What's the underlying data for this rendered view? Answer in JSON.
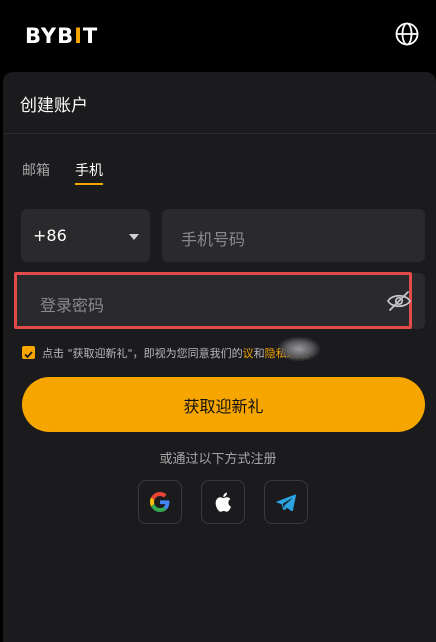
{
  "header": {
    "logo_main": "BYB",
    "logo_bar": "I",
    "logo_end": "T"
  },
  "form": {
    "title": "创建账户",
    "tabs": [
      {
        "label": "邮箱",
        "active": false
      },
      {
        "label": "手机",
        "active": true
      }
    ],
    "country_code": "+86",
    "phone_placeholder": "手机号码",
    "password_placeholder": "登录密码",
    "agree_prefix": "点击 \"获取迎新礼\"，即视为您同意我们的",
    "agree_link_partial": "议",
    "agree_and": "和",
    "privacy_link": "隐私政策",
    "submit_label": "获取迎新礼",
    "or_register": "或通过以下方式注册"
  },
  "social": [
    {
      "icon": "google-icon"
    },
    {
      "icon": "apple-icon"
    },
    {
      "icon": "telegram-icon"
    }
  ],
  "colors": {
    "accent": "#f7a600",
    "highlight": "#e34b4b",
    "card_bg": "#1b1b1d",
    "input_bg": "#2a2a2d"
  }
}
